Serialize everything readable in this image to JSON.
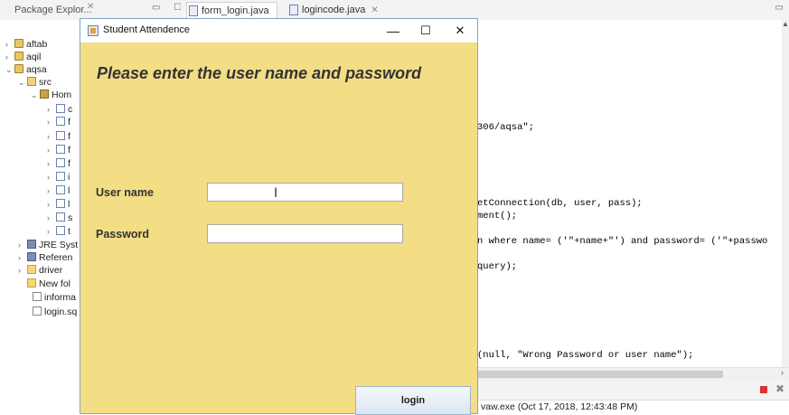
{
  "eclipse": {
    "package_explorer_tab": "Package Explor...",
    "editor_tabs": [
      {
        "label": "form_login.java"
      },
      {
        "label": "logincode.java"
      }
    ],
    "tree": [
      {
        "label": "aftab"
      },
      {
        "label": "aqil"
      },
      {
        "label": "aqsa"
      },
      {
        "label": "src"
      },
      {
        "label": "Hom"
      },
      {
        "label": "c"
      },
      {
        "label": "f"
      },
      {
        "label": "f"
      },
      {
        "label": "f"
      },
      {
        "label": "f"
      },
      {
        "label": "i"
      },
      {
        "label": "l"
      },
      {
        "label": "l"
      },
      {
        "label": "s"
      },
      {
        "label": "t"
      },
      {
        "label": "JRE Syst"
      },
      {
        "label": "Referen"
      },
      {
        "label": "driver"
      },
      {
        "label": "New fol"
      },
      {
        "label": "informa"
      },
      {
        "label": "login.sq"
      }
    ],
    "code_lines": [
      {
        "text": "306/aqsa\";"
      },
      {
        "text": "etConnection(db, user, pass);"
      },
      {
        "text": "ment();"
      },
      {
        "text": "n where name= ('\"+name+\"') and password= ('\"+passwo"
      },
      {
        "text": "query);"
      },
      {
        "text": "(null, \"Wrong Password or user name\");"
      }
    ],
    "console_text": "vaw.exe (Oct 17, 2018, 12:43:48 PM)"
  },
  "dialog": {
    "title": "Student Attendence",
    "minimize": "—",
    "maximize": "☐",
    "close": "✕",
    "heading": "Please enter the user name and password",
    "username_label": "User name",
    "username_value": "",
    "password_label": "Password",
    "password_value": "",
    "login_label": "login"
  },
  "colors": {
    "dialog_background": "#f3dd85",
    "string_literal": "#2a00ff"
  }
}
